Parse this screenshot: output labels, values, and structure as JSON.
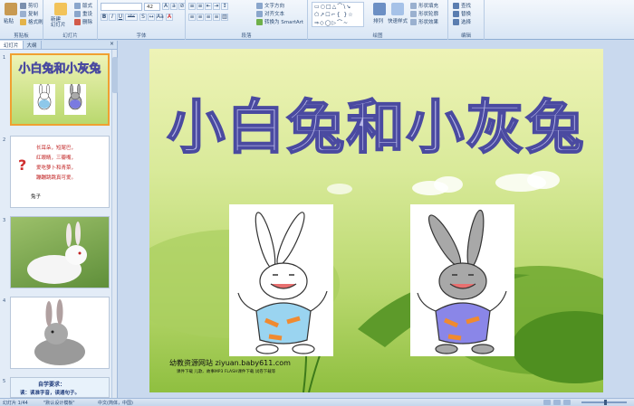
{
  "ribbon": {
    "clipboard": {
      "paste": "粘贴",
      "cut": "剪切",
      "copy": "复制",
      "format_painter": "格式刷",
      "label": "剪贴板"
    },
    "slides": {
      "new_slide": "新建\n幻灯片",
      "layout": "版式",
      "reset": "重设",
      "delete": "删除",
      "label": "幻灯片"
    },
    "font": {
      "size": "42",
      "bold": "B",
      "italic": "I",
      "underline": "U",
      "strike": "abc",
      "shadow": "S",
      "label": "字体"
    },
    "paragraph": {
      "text_direction": "文字方向",
      "align_text": "对齐文本",
      "smartart": "转换为 SmartArt",
      "label": "段落"
    },
    "drawing": {
      "arrange": "排列",
      "quick_styles": "快速样式",
      "shape_fill": "形状填充",
      "shape_outline": "形状轮廓",
      "shape_effects": "形状效果",
      "label": "绘图"
    },
    "editing": {
      "find": "查找",
      "replace": "替换",
      "select": "选择",
      "label": "编辑"
    }
  },
  "pane": {
    "tabs": [
      "幻灯片",
      "大纲"
    ],
    "close": "×",
    "slides": [
      {
        "num": "1",
        "title": "小白兔和小灰兔"
      },
      {
        "num": "2",
        "lines": [
          "长耳朵，短尾巴，",
          "红眼睛，三瓣嘴，",
          "爱吃萝卜和青菜，",
          "蹦蹦跳跳真可爱。"
        ],
        "answer": "兔子"
      },
      {
        "num": "3"
      },
      {
        "num": "4"
      },
      {
        "num": "5",
        "lines": [
          "自学要求：",
          "读：读准字音，读通句子。"
        ]
      }
    ]
  },
  "slide": {
    "title": "小白兔和小灰兔",
    "site": "幼教资源网站  ziyuan.baby611.com",
    "site_sub": "课件下载   儿歌、故事MP3   FLASH课件下载   试卷下载等"
  },
  "status": {
    "slide_info": "幻灯片 1/44",
    "theme": "\"默认设计模板\"",
    "language": "中文(简体，中国)"
  },
  "colors": {
    "title_stroke": "#4a4aa0",
    "title_fill": "#b8b8e8",
    "selected_border": "#f0a030",
    "ribbon_bg": "#dae6f5"
  }
}
